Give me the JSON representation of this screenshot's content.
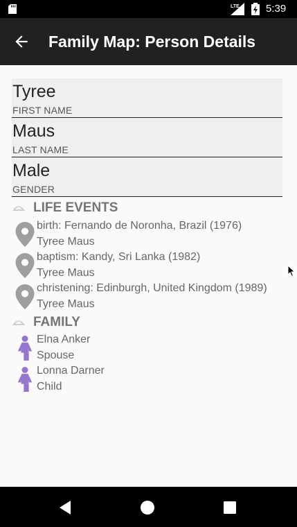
{
  "status_bar": {
    "time": "5:39",
    "network_label": "LTE",
    "icons": [
      "sd-card-icon",
      "signal-icon",
      "battery-icon"
    ]
  },
  "app_bar": {
    "title": "Family Map: Person Details",
    "back_icon": "arrow-back-icon"
  },
  "person": {
    "first_name": {
      "value": "Tyree",
      "label": "FIRST NAME"
    },
    "last_name": {
      "value": "Maus",
      "label": "LAST NAME"
    },
    "gender": {
      "value": "Male",
      "label": "GENDER"
    }
  },
  "life_events": {
    "header": "LIFE EVENTS",
    "expanded_icon": "chevron-up-icon",
    "items": [
      {
        "description": "birth: Fernando de Noronha, Brazil (1976)",
        "person": "Tyree Maus",
        "icon": "map-marker-icon"
      },
      {
        "description": "baptism: Kandy, Sri Lanka (1982)",
        "person": "Tyree Maus",
        "icon": "map-marker-icon"
      },
      {
        "description": "christening: Edinburgh, United Kingdom (1989)",
        "person": "Tyree Maus",
        "icon": "map-marker-icon"
      }
    ]
  },
  "family": {
    "header": "FAMILY",
    "expanded_icon": "chevron-up-icon",
    "items": [
      {
        "name": "Elna Anker",
        "relationship": "Spouse",
        "icon": "female-icon"
      },
      {
        "name": "Lonna Darner",
        "relationship": "Child",
        "icon": "female-icon"
      }
    ]
  },
  "nav_bar": {
    "icons": [
      "nav-back-icon",
      "nav-home-icon",
      "nav-recents-icon"
    ]
  },
  "colors": {
    "app_bar": "#212121",
    "background": "#fafafa",
    "field_background": "#efefef",
    "marker_gray": "#9e9e9e",
    "female_purple": "#9575cd",
    "section_text": "#757575"
  }
}
